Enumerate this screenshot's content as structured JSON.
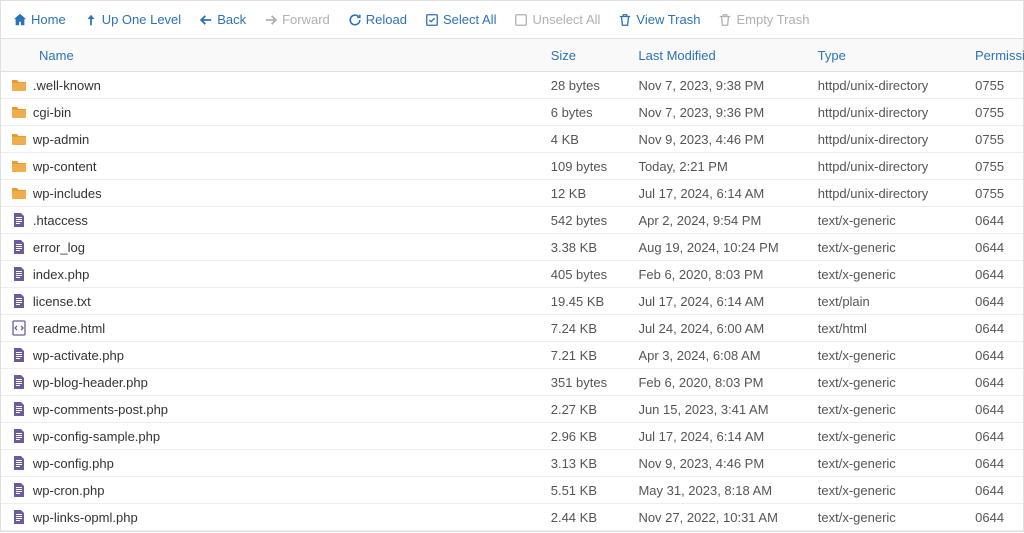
{
  "toolbar": {
    "home": "Home",
    "up_one_level": "Up One Level",
    "back": "Back",
    "forward": "Forward",
    "reload": "Reload",
    "select_all": "Select All",
    "unselect_all": "Unselect All",
    "view_trash": "View Trash",
    "empty_trash": "Empty Trash"
  },
  "columns": {
    "name": "Name",
    "size": "Size",
    "modified": "Last Modified",
    "type": "Type",
    "permissions": "Permissio"
  },
  "files": [
    {
      "icon": "folder",
      "name": ".well-known",
      "size": "28 bytes",
      "modified": "Nov 7, 2023, 9:38 PM",
      "type": "httpd/unix-directory",
      "perms": "0755"
    },
    {
      "icon": "folder",
      "name": "cgi-bin",
      "size": "6 bytes",
      "modified": "Nov 7, 2023, 9:36 PM",
      "type": "httpd/unix-directory",
      "perms": "0755"
    },
    {
      "icon": "folder",
      "name": "wp-admin",
      "size": "4 KB",
      "modified": "Nov 9, 2023, 4:46 PM",
      "type": "httpd/unix-directory",
      "perms": "0755"
    },
    {
      "icon": "folder",
      "name": "wp-content",
      "size": "109 bytes",
      "modified": "Today, 2:21 PM",
      "type": "httpd/unix-directory",
      "perms": "0755"
    },
    {
      "icon": "folder",
      "name": "wp-includes",
      "size": "12 KB",
      "modified": "Jul 17, 2024, 6:14 AM",
      "type": "httpd/unix-directory",
      "perms": "0755"
    },
    {
      "icon": "file",
      "name": ".htaccess",
      "size": "542 bytes",
      "modified": "Apr 2, 2024, 9:54 PM",
      "type": "text/x-generic",
      "perms": "0644"
    },
    {
      "icon": "file",
      "name": "error_log",
      "size": "3.38 KB",
      "modified": "Aug 19, 2024, 10:24 PM",
      "type": "text/x-generic",
      "perms": "0644"
    },
    {
      "icon": "file",
      "name": "index.php",
      "size": "405 bytes",
      "modified": "Feb 6, 2020, 8:03 PM",
      "type": "text/x-generic",
      "perms": "0644"
    },
    {
      "icon": "file",
      "name": "license.txt",
      "size": "19.45 KB",
      "modified": "Jul 17, 2024, 6:14 AM",
      "type": "text/plain",
      "perms": "0644"
    },
    {
      "icon": "html",
      "name": "readme.html",
      "size": "7.24 KB",
      "modified": "Jul 24, 2024, 6:00 AM",
      "type": "text/html",
      "perms": "0644"
    },
    {
      "icon": "file",
      "name": "wp-activate.php",
      "size": "7.21 KB",
      "modified": "Apr 3, 2024, 6:08 AM",
      "type": "text/x-generic",
      "perms": "0644"
    },
    {
      "icon": "file",
      "name": "wp-blog-header.php",
      "size": "351 bytes",
      "modified": "Feb 6, 2020, 8:03 PM",
      "type": "text/x-generic",
      "perms": "0644"
    },
    {
      "icon": "file",
      "name": "wp-comments-post.php",
      "size": "2.27 KB",
      "modified": "Jun 15, 2023, 3:41 AM",
      "type": "text/x-generic",
      "perms": "0644"
    },
    {
      "icon": "file",
      "name": "wp-config-sample.php",
      "size": "2.96 KB",
      "modified": "Jul 17, 2024, 6:14 AM",
      "type": "text/x-generic",
      "perms": "0644"
    },
    {
      "icon": "file",
      "name": "wp-config.php",
      "size": "3.13 KB",
      "modified": "Nov 9, 2023, 4:46 PM",
      "type": "text/x-generic",
      "perms": "0644"
    },
    {
      "icon": "file",
      "name": "wp-cron.php",
      "size": "5.51 KB",
      "modified": "May 31, 2023, 8:18 AM",
      "type": "text/x-generic",
      "perms": "0644"
    },
    {
      "icon": "file",
      "name": "wp-links-opml.php",
      "size": "2.44 KB",
      "modified": "Nov 27, 2022, 10:31 AM",
      "type": "text/x-generic",
      "perms": "0644"
    }
  ],
  "colors": {
    "link": "#2c72b8",
    "disabled": "#b0b0b0",
    "folder": "#f0ad4e",
    "file": "#6c5b9e"
  }
}
